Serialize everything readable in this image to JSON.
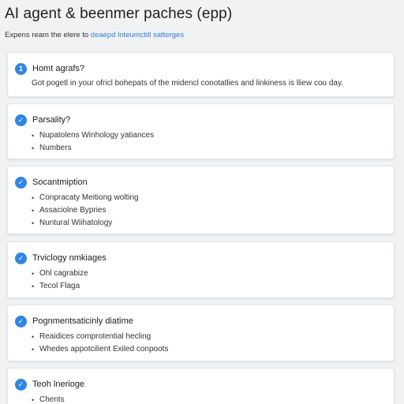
{
  "header": {
    "title": "AI agent & beenmer paches (epp)",
    "subtitle_prefix": "Expens ream the elere to",
    "subtitle_link": "deaepd lnteumctill satterges"
  },
  "cards": [
    {
      "badge": "1",
      "title": "Homt agrafs?",
      "body": "Got pogetl in your ofricl bohepats of the midencl conotatlies and linkiness is lliew cou day."
    },
    {
      "badge": "✓",
      "title": "Parsality?",
      "items": [
        "Nupatolens Winhology yatiances",
        "Numbers"
      ]
    },
    {
      "badge": "✓",
      "title": "Socantmiption",
      "items": [
        "Conpracaty Meitiong wolting",
        "Assaciolne Bypries",
        "Nuntural Wiihatology"
      ]
    },
    {
      "badge": "✓",
      "title": "Trviclogy nmkiages",
      "items": [
        "Ohl cagrabize",
        "Tecol Flaga"
      ]
    },
    {
      "badge": "✓",
      "title": "Pognmentsaticinly diatime",
      "items": [
        "Reaidices comprotential hecling",
        "Whedes appotcilient Exiled conpoots"
      ]
    },
    {
      "badge": "✓",
      "title": "Teoh lnerioge",
      "items": [
        "Chents"
      ]
    }
  ],
  "colors": {
    "accent": "#2f86e6",
    "link": "#2f7fd8",
    "background": "#f1f2f4",
    "card": "#ffffff"
  }
}
